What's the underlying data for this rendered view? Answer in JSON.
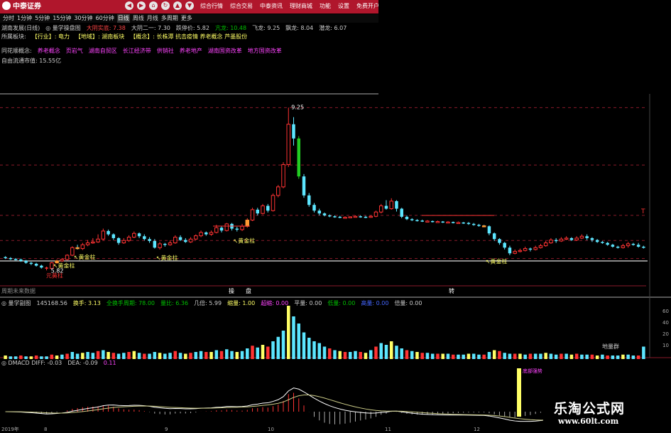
{
  "top": {
    "logo": "中泰证券",
    "nav_icons": [
      "back-icon",
      "forward-icon",
      "home-icon",
      "refresh-icon",
      "up-icon",
      "down-icon"
    ],
    "menu": [
      "综合行情",
      "综合交易",
      "中泰资讯",
      "理财商城",
      "功能",
      "设置",
      "免费开户"
    ]
  },
  "periods": [
    "分时",
    "1分钟",
    "5分钟",
    "15分钟",
    "30分钟",
    "60分钟",
    "日线",
    "周线",
    "月线",
    "多周期",
    "更多"
  ],
  "active_period": "日线",
  "info": {
    "line1": [
      {
        "t": "湖南发展(日线)",
        "c": "#cccccc"
      },
      {
        "t": "◎ 量学操盘图",
        "c": "#cccccc"
      },
      {
        "t": "大阴实底: 7.38",
        "c": "#ff4444"
      },
      {
        "t": "大阴二一: 7.30",
        "c": "#cccccc"
      },
      {
        "t": "跌停价: 5.82",
        "c": "#cccccc"
      },
      {
        "t": "亢龙: 10.48",
        "c": "#00c000"
      },
      {
        "t": "飞龙: 9.25",
        "c": "#cccccc"
      },
      {
        "t": "飘龙: 8.04",
        "c": "#cccccc"
      },
      {
        "t": "潜龙: 6.07",
        "c": "#cccccc"
      }
    ],
    "line2": [
      {
        "t": "所属板块:",
        "c": "#cccccc"
      },
      {
        "t": "【行业】: 电力",
        "c": "#ffff66"
      },
      {
        "t": "【地域】: 湖南板块",
        "c": "#ffff66"
      },
      {
        "t": "【概念】: 长株潭 抗击疫情 养老概念 芦墨股份",
        "c": "#ffff66"
      }
    ],
    "line3": [
      {
        "t": "同花顺概念:",
        "c": "#cccccc"
      },
      {
        "t": "养老概念",
        "c": "#ff44ff"
      },
      {
        "t": "页岩气",
        "c": "#ff44ff"
      },
      {
        "t": "湖南自贸区",
        "c": "#ff44ff"
      },
      {
        "t": "长江经济带",
        "c": "#ff44ff"
      },
      {
        "t": "供销社",
        "c": "#ff44ff"
      },
      {
        "t": "养老地产",
        "c": "#ff44ff"
      },
      {
        "t": "湖南国资改革",
        "c": "#ff44ff"
      },
      {
        "t": "地方国资改革",
        "c": "#ff44ff"
      }
    ],
    "line4": "自由流通市值: 15.55亿"
  },
  "main_labels": {
    "high": "9.25",
    "low": "5.82",
    "golden": "黄金柱",
    "launch": "元黄柱",
    "right_t": "T",
    "footer": "周期未来数据",
    "signal_a": "操",
    "signal_b": "盘",
    "signal_c": "转"
  },
  "vol_panel": {
    "header": [
      {
        "t": "◎ 量学副图",
        "c": "#cccccc"
      },
      {
        "t": "145168.56",
        "c": "#cccccc"
      },
      {
        "t": "换手: 3.13",
        "c": "#ffff66"
      },
      {
        "t": "全换手周期: 78.00",
        "c": "#00c000"
      },
      {
        "t": "量比: 6.36",
        "c": "#00c000"
      },
      {
        "t": "几倍: 5.99",
        "c": "#cccccc"
      },
      {
        "t": "缩量: 1.00",
        "c": "#ffff66"
      },
      {
        "t": "超缩: 0.00",
        "c": "#ff44ff"
      },
      {
        "t": "平量: 0.00",
        "c": "#cccccc"
      },
      {
        "t": "低量: 0.00",
        "c": "#00c000"
      },
      {
        "t": "高量: 0.00",
        "c": "#4466ff"
      },
      {
        "t": "倍量: 0.00",
        "c": "#cccccc"
      }
    ],
    "label": "地量群",
    "axis": [
      "60",
      "40",
      "20",
      "10"
    ]
  },
  "macd_panel": {
    "header": [
      {
        "t": "◎ DMACD DIFF: -0.03",
        "c": "#cccccc"
      },
      {
        "t": "DEA: -0.09",
        "c": "#cccccc"
      },
      {
        "t": "0.11",
        "c": "#ff44ff"
      }
    ],
    "label": "底部强势",
    "dates": [
      "2019年",
      "8",
      "9",
      "10",
      "11",
      "12"
    ]
  },
  "watermark": {
    "title": "乐淘公式网",
    "url": "www.60lt.com"
  },
  "colors": {
    "up": "#ff3333",
    "down": "#5ce6ff",
    "yellow": "#ffff66",
    "purple": "#ff44ff",
    "green": "#22cc22",
    "orange": "#ff9933",
    "white": "#ffffff",
    "grid": "#8a1a2a",
    "redbar": "#b0162c"
  },
  "chart_data": {
    "type": "candlestick",
    "title": "湖南发展(日线)",
    "ylim": [
      5.6,
      9.6
    ],
    "candles": [
      [
        6.1,
        6.08,
        6.12,
        6.06
      ],
      [
        6.08,
        6.06,
        6.1,
        6.04
      ],
      [
        6.06,
        6.05,
        6.08,
        6.03
      ],
      [
        6.05,
        6.02,
        6.07,
        6.0
      ],
      [
        6.02,
        5.98,
        6.04,
        5.96
      ],
      [
        5.98,
        5.96,
        6.0,
        5.93
      ],
      [
        5.96,
        5.92,
        5.98,
        5.9
      ],
      [
        5.92,
        5.88,
        5.94,
        5.86
      ],
      [
        5.88,
        5.86,
        5.9,
        5.82
      ],
      [
        5.86,
        5.98,
        6.0,
        5.85
      ],
      [
        5.98,
        6.02,
        6.05,
        5.96
      ],
      [
        6.02,
        6.05,
        6.08,
        6.0
      ],
      [
        6.05,
        6.14,
        6.16,
        6.03
      ],
      [
        6.14,
        6.3,
        6.33,
        6.12
      ],
      [
        6.3,
        6.28,
        6.36,
        6.26
      ],
      [
        6.28,
        6.36,
        6.4,
        6.25
      ],
      [
        6.36,
        6.4,
        6.46,
        6.33
      ],
      [
        6.4,
        6.42,
        6.5,
        6.38
      ],
      [
        6.42,
        6.48,
        6.58,
        6.4
      ],
      [
        6.48,
        6.65,
        6.7,
        6.45
      ],
      [
        6.65,
        6.58,
        6.68,
        6.55
      ],
      [
        6.58,
        6.5,
        6.6,
        6.46
      ],
      [
        6.5,
        6.4,
        6.52,
        6.36
      ],
      [
        6.4,
        6.45,
        6.5,
        6.38
      ],
      [
        6.45,
        6.52,
        6.56,
        6.42
      ],
      [
        6.52,
        6.6,
        6.64,
        6.5
      ],
      [
        6.6,
        6.54,
        6.62,
        6.5
      ],
      [
        6.54,
        6.48,
        6.58,
        6.45
      ],
      [
        6.48,
        6.44,
        6.52,
        6.4
      ],
      [
        6.44,
        6.3,
        6.48,
        6.28
      ],
      [
        6.3,
        6.38,
        6.42,
        6.26
      ],
      [
        6.38,
        6.36,
        6.4,
        6.32
      ],
      [
        6.36,
        6.4,
        6.45,
        6.34
      ],
      [
        6.4,
        6.52,
        6.56,
        6.38
      ],
      [
        6.52,
        6.46,
        6.56,
        6.44
      ],
      [
        6.46,
        6.42,
        6.5,
        6.4
      ],
      [
        6.42,
        6.48,
        6.52,
        6.4
      ],
      [
        6.48,
        6.55,
        6.58,
        6.46
      ],
      [
        6.55,
        6.62,
        6.66,
        6.52
      ],
      [
        6.62,
        6.58,
        6.64,
        6.55
      ],
      [
        6.58,
        6.62,
        6.66,
        6.55
      ],
      [
        6.62,
        6.72,
        6.78,
        6.6
      ],
      [
        6.72,
        6.66,
        6.76,
        6.62
      ],
      [
        6.66,
        6.8,
        6.82,
        6.64
      ],
      [
        6.8,
        6.7,
        6.82,
        6.66
      ],
      [
        6.7,
        6.68,
        6.74,
        6.64
      ],
      [
        6.68,
        6.75,
        6.8,
        6.65
      ],
      [
        6.75,
        6.88,
        6.92,
        6.72
      ],
      [
        6.88,
        7.1,
        7.14,
        6.86
      ],
      [
        7.1,
        7.02,
        7.14,
        6.98
      ],
      [
        7.02,
        7.18,
        7.22,
        7.0
      ],
      [
        7.18,
        7.08,
        7.22,
        7.04
      ],
      [
        7.08,
        7.4,
        7.44,
        7.06
      ],
      [
        7.4,
        7.58,
        7.62,
        7.36
      ],
      [
        7.58,
        8.05,
        8.1,
        7.55
      ],
      [
        8.05,
        8.9,
        9.25,
        8.0
      ],
      [
        8.9,
        8.6,
        9.05,
        8.45
      ],
      [
        8.6,
        7.8,
        8.65,
        7.75
      ],
      [
        7.8,
        7.4,
        7.85,
        7.35
      ],
      [
        7.4,
        7.2,
        7.45,
        7.16
      ],
      [
        7.2,
        7.08,
        7.24,
        7.04
      ],
      [
        7.08,
        7.02,
        7.12,
        6.98
      ],
      [
        7.02,
        6.98,
        7.04,
        6.96
      ],
      [
        6.98,
        6.96,
        7.0,
        6.94
      ],
      [
        6.96,
        6.95,
        6.98,
        6.93
      ],
      [
        6.95,
        6.94,
        6.97,
        6.92
      ],
      [
        6.94,
        6.94,
        6.96,
        6.92
      ],
      [
        6.94,
        6.95,
        6.96,
        6.93
      ],
      [
        6.95,
        6.96,
        6.98,
        6.94
      ],
      [
        6.96,
        6.95,
        6.98,
        6.93
      ],
      [
        6.95,
        6.94,
        6.97,
        6.92
      ],
      [
        6.94,
        6.96,
        6.98,
        6.93
      ],
      [
        6.96,
        7.05,
        7.08,
        6.94
      ],
      [
        7.05,
        7.18,
        7.22,
        7.02
      ],
      [
        7.18,
        7.12,
        7.3,
        7.1
      ],
      [
        7.12,
        7.28,
        7.34,
        7.1
      ],
      [
        7.28,
        7.12,
        7.3,
        7.06
      ],
      [
        7.12,
        6.95,
        7.14,
        6.92
      ],
      [
        6.95,
        6.9,
        6.98,
        6.88
      ],
      [
        6.9,
        6.88,
        6.92,
        6.86
      ],
      [
        6.88,
        6.87,
        6.9,
        6.85
      ],
      [
        6.87,
        6.86,
        6.89,
        6.84
      ],
      [
        6.86,
        6.86,
        6.88,
        6.84
      ],
      [
        6.86,
        6.85,
        6.87,
        6.83
      ],
      [
        6.85,
        6.85,
        6.87,
        6.83
      ],
      [
        6.85,
        6.84,
        6.86,
        6.82
      ],
      [
        6.84,
        6.84,
        6.86,
        6.82
      ],
      [
        6.84,
        6.83,
        6.85,
        6.81
      ],
      [
        6.83,
        6.83,
        6.85,
        6.81
      ],
      [
        6.83,
        6.82,
        6.84,
        6.8
      ],
      [
        6.82,
        6.8,
        6.84,
        6.78
      ],
      [
        6.8,
        6.78,
        6.82,
        6.76
      ],
      [
        6.78,
        6.76,
        6.8,
        6.74
      ],
      [
        6.76,
        6.75,
        6.78,
        6.73
      ],
      [
        6.75,
        6.6,
        6.77,
        6.56
      ],
      [
        6.6,
        6.48,
        6.62,
        6.44
      ],
      [
        6.48,
        6.4,
        6.5,
        6.36
      ],
      [
        6.4,
        6.3,
        6.42,
        6.26
      ],
      [
        6.3,
        6.18,
        6.34,
        6.14
      ],
      [
        6.18,
        6.22,
        6.26,
        6.16
      ],
      [
        6.22,
        6.24,
        6.28,
        6.2
      ],
      [
        6.24,
        6.28,
        6.32,
        6.22
      ],
      [
        6.28,
        6.26,
        6.3,
        6.22
      ],
      [
        6.26,
        6.3,
        6.34,
        6.24
      ],
      [
        6.3,
        6.34,
        6.38,
        6.28
      ],
      [
        6.34,
        6.4,
        6.44,
        6.32
      ],
      [
        6.4,
        6.46,
        6.5,
        6.38
      ],
      [
        6.46,
        6.44,
        6.5,
        6.4
      ],
      [
        6.44,
        6.48,
        6.52,
        6.42
      ],
      [
        6.48,
        6.5,
        6.54,
        6.46
      ],
      [
        6.5,
        6.46,
        6.52,
        6.44
      ],
      [
        6.46,
        6.5,
        6.54,
        6.44
      ],
      [
        6.5,
        6.54,
        6.58,
        6.48
      ],
      [
        6.54,
        6.5,
        6.58,
        6.46
      ],
      [
        6.5,
        6.46,
        6.52,
        6.42
      ],
      [
        6.46,
        6.42,
        6.48,
        6.4
      ],
      [
        6.42,
        6.4,
        6.44,
        6.38
      ],
      [
        6.4,
        6.36,
        6.42,
        6.34
      ],
      [
        6.36,
        6.32,
        6.38,
        6.3
      ],
      [
        6.32,
        6.3,
        6.34,
        6.28
      ],
      [
        6.3,
        6.34,
        6.38,
        6.28
      ],
      [
        6.34,
        6.38,
        6.42,
        6.3
      ],
      [
        6.38,
        6.36,
        6.4,
        6.34
      ],
      [
        6.36,
        6.32,
        6.4,
        6.3
      ],
      [
        6.32,
        6.3,
        6.34,
        6.28
      ]
    ],
    "levels": [
      9.25,
      8.04,
      6.98,
      6.45,
      6.07
    ],
    "volume": [
      4,
      3,
      3,
      4,
      3,
      3,
      4,
      3,
      3,
      5,
      4,
      5,
      6,
      8,
      6,
      7,
      8,
      7,
      9,
      10,
      8,
      7,
      6,
      7,
      8,
      9,
      7,
      6,
      6,
      8,
      7,
      6,
      7,
      9,
      7,
      6,
      7,
      8,
      9,
      8,
      8,
      10,
      9,
      11,
      9,
      8,
      9,
      12,
      15,
      13,
      16,
      14,
      20,
      25,
      32,
      60,
      48,
      40,
      30,
      24,
      20,
      18,
      14,
      12,
      10,
      9,
      8,
      8,
      9,
      8,
      7,
      10,
      14,
      18,
      16,
      20,
      15,
      12,
      10,
      9,
      8,
      7,
      7,
      6,
      6,
      6,
      6,
      5,
      5,
      5,
      6,
      6,
      5,
      5,
      8,
      10,
      9,
      7,
      6,
      6,
      6,
      5,
      6,
      6,
      6,
      7,
      6,
      5,
      6,
      6,
      5,
      6,
      5,
      5,
      5,
      4,
      5,
      4,
      4,
      4,
      5,
      5,
      4,
      4,
      14
    ]
  }
}
